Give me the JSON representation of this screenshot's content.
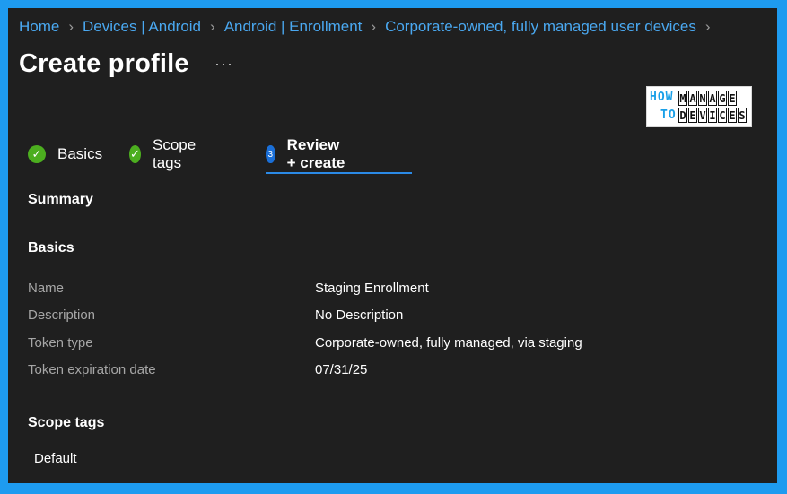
{
  "breadcrumb": [
    "Home",
    "Devices | Android",
    "Android | Enrollment",
    "Corporate-owned, fully managed user devices"
  ],
  "page": {
    "title": "Create profile",
    "more": "···"
  },
  "logo": {
    "how": "HOW",
    "to": "TO",
    "manage": [
      "M",
      "A",
      "N",
      "A",
      "G",
      "E"
    ],
    "devices": [
      "D",
      "E",
      "V",
      "I",
      "C",
      "E",
      "S"
    ]
  },
  "tabs": {
    "basics": "Basics",
    "scope_tags": "Scope tags",
    "review_create": "Review + create",
    "active_step": "3"
  },
  "summary": {
    "heading": "Summary",
    "basics_heading": "Basics",
    "rows": [
      {
        "label": "Name",
        "value": "Staging Enrollment"
      },
      {
        "label": "Description",
        "value": "No Description"
      },
      {
        "label": "Token type",
        "value": "Corporate-owned, fully managed, via staging"
      },
      {
        "label": "Token expiration date",
        "value": "07/31/25"
      }
    ],
    "scope_tags_heading": "Scope tags",
    "scope_tag_value": "Default"
  },
  "colors": {
    "accent": "#4aa8f0",
    "frame": "#1e9bf0",
    "background": "#1f1f1f",
    "success": "#4cae1f"
  },
  "icons": [
    "chevron-right-icon",
    "ellipsis-icon",
    "checkmark-icon"
  ]
}
